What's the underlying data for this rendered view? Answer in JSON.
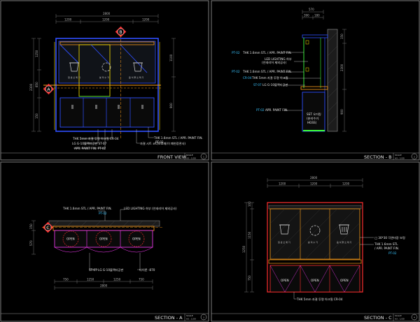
{
  "panels": {
    "front": {
      "title": "FRONT VIEW",
      "num": "1",
      "scale_label": "SCALE",
      "scale_value": "A3 : 1/30",
      "markers": {
        "a": "A",
        "b": "B"
      },
      "icon_labels": [
        "일 반 쓰 레 기",
        "분 리 수 거",
        "음 식 물 쓰 레 기"
      ],
      "notes": [
        "THK 1.6mm STL / APR. PAINT FIN.",
        "PT-02",
        "THK 5mm 자결 투명 아크릴 CR-04",
        "LG G-10블랙타공판 ST-07",
        "APR. PAINT FIN. PT-02",
        "자결 시트 코너보호재(이 폐현장관사)"
      ],
      "dims": [
        "2800",
        "1200",
        "900",
        "2300",
        "1250",
        "600",
        "150",
        "350",
        "850",
        "1100"
      ]
    },
    "section_b": {
      "title": "SECTION - B",
      "num": "2",
      "scale_label": "SCALE",
      "scale_value": "A3 : 1/30",
      "notes": [
        "PT-02",
        "THK 1.6mm STL / APR. PAINT FIN.",
        "LED LIGHTING 하부",
        "(인테리어 제외공사)",
        "PT-02",
        "THK 1.6mm STL / APR. PAINT FIN.",
        "CR-04",
        "THK 5mm 자결 투명 아크릴",
        "ST-07",
        "LG G-10블랙타공판",
        "PT-02",
        "APR. PAINT FIN.",
        "SST 오거킹",
        "(분리수거",
        "HGSS)"
      ],
      "dims": [
        "570",
        "390",
        "180",
        "150",
        "2300",
        "350",
        "900",
        "1100"
      ]
    },
    "section_a": {
      "title": "SECTION - A",
      "num": "3",
      "scale_label": "SCALE",
      "scale_value": "A3 : 1/30",
      "marker": "C",
      "open_labels": [
        "OPEN",
        "OPEN",
        "OPEN"
      ],
      "notes": [
        "THK 1.6mm STL / APR. PAINT FIN.",
        "PT-02",
        "LED LIGHTING 하부 (인테리어 제외공사)",
        "ST-07  LG G-10블랙타공판",
        "타이론 -870"
      ],
      "dims": [
        "2800",
        "150",
        "570",
        "1250",
        "750",
        "600",
        "2000"
      ]
    },
    "section_c": {
      "title": "SECTION - C",
      "num": "4",
      "scale_label": "SCALE",
      "scale_value": "A3 : 1/30",
      "icon_labels": [
        "일 반 쓰 레 기",
        "분 리 수 거",
        "음 식 물 쓰 레 기"
      ],
      "open_labels": [
        "OPEN",
        "OPEN",
        "OPEN"
      ],
      "notes": [
        "□ 30*30 각관미장 보정",
        "THK 1.6mm STL",
        "/ APR. PAINT FIN.",
        "PT-02",
        "THK 5mm 자결 투명 아크릴 CR-04"
      ],
      "dims": [
        "2800",
        "600",
        "1200",
        "100",
        "750",
        "650",
        "350",
        "850",
        "1150",
        "1250"
      ]
    }
  },
  "colors": {
    "frame": "#9a9a9a",
    "cabinet": "#2f4fff",
    "accent_orange": "#ff9f1a",
    "accent_yellow": "#ffe600",
    "accent_green": "#3dff3d",
    "accent_red": "#ff3030",
    "accent_magenta": "#ff3cff",
    "dim": "#8a8a8a"
  }
}
